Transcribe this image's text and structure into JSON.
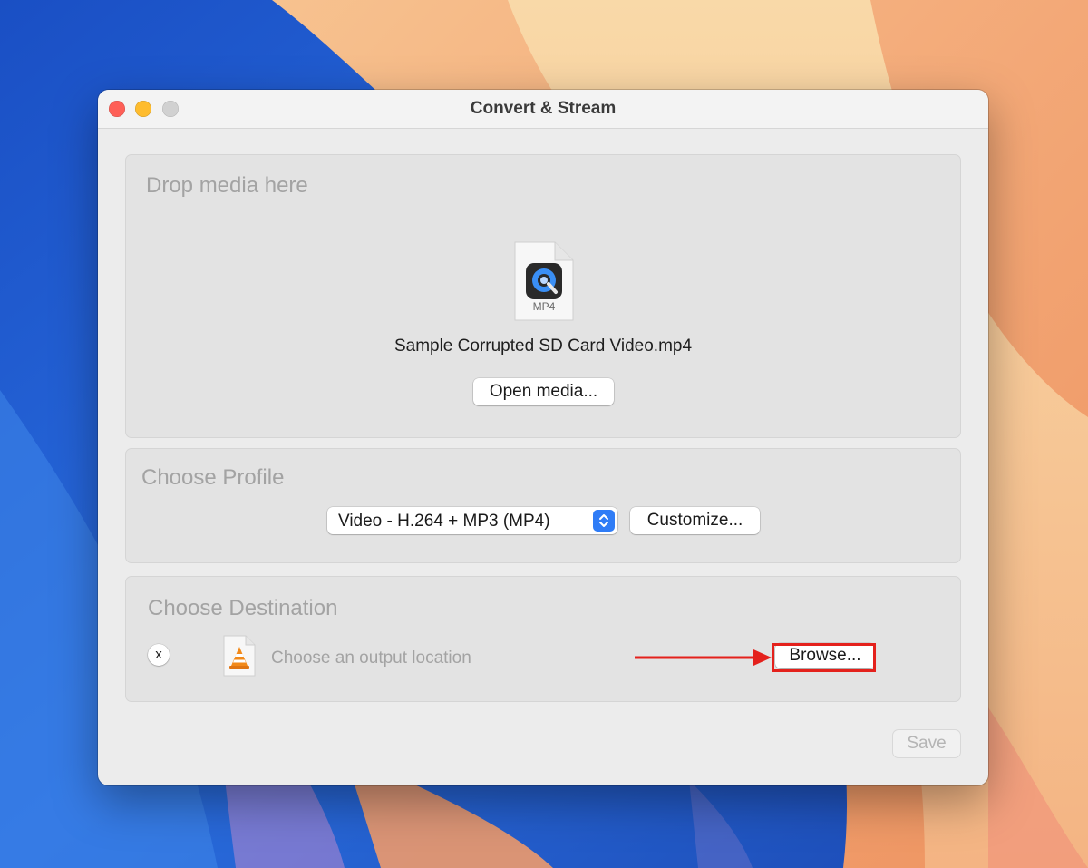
{
  "window": {
    "title": "Convert & Stream"
  },
  "source": {
    "heading": "Drop media here",
    "file_icon_label": "MP4",
    "file_name": "Sample Corrupted SD Card Video.mp4",
    "open_button": "Open media..."
  },
  "profile": {
    "heading": "Choose Profile",
    "selected": "Video - H.264 + MP3 (MP4)",
    "customize_button": "Customize..."
  },
  "destination": {
    "heading": "Choose Destination",
    "clear_label": "x",
    "placeholder": "Choose an output location",
    "browse_button": "Browse..."
  },
  "footer": {
    "save_button": "Save"
  },
  "colors": {
    "highlight": "#e4211c",
    "select_accent": "#2f7cf6"
  },
  "icons": {
    "source_file": "quicktime-mp4-file-icon",
    "destination_file": "vlc-cone-file-icon",
    "annotation": "red-arrow-icon"
  }
}
